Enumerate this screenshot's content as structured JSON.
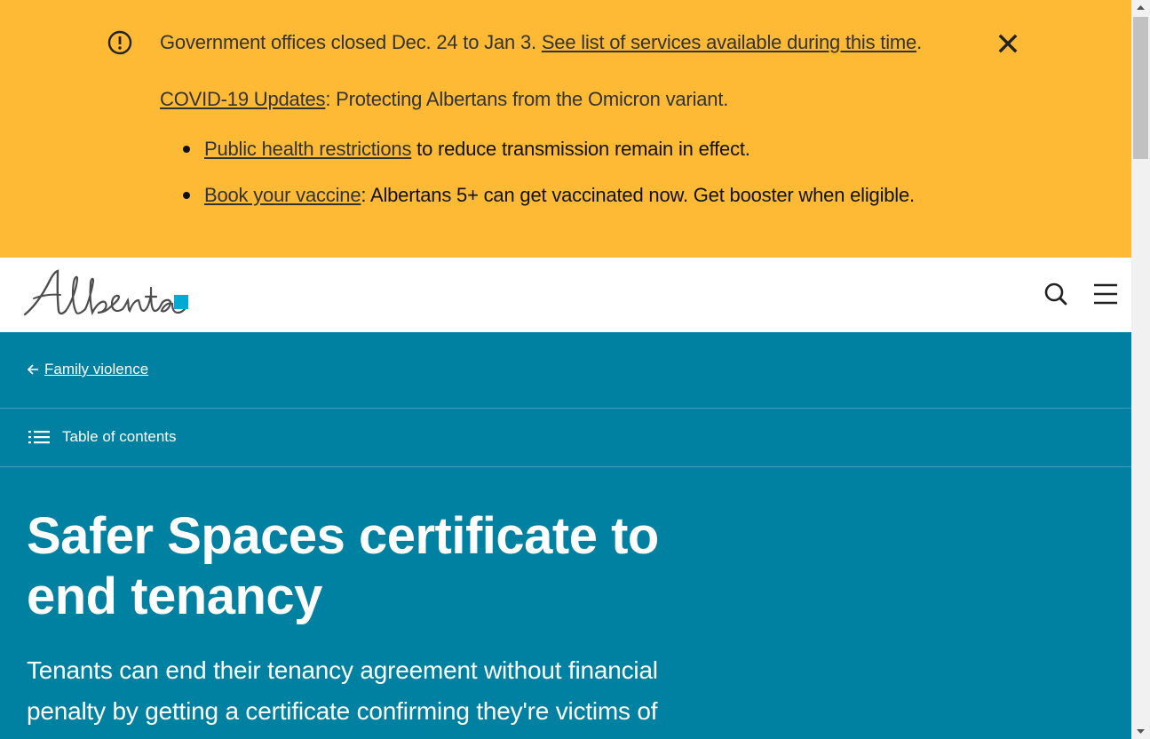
{
  "alert": {
    "icon": "exclamation-circle-icon",
    "line1_text": "Government offices closed Dec. 24 to Jan 3. ",
    "line1_link": "See list of services available during this time",
    "line1_end": ".",
    "line2_link": "COVID-19 Updates",
    "line2_text": ": Protecting Albertans from the Omicron variant.",
    "bullets": [
      {
        "link": "Public health restrictions",
        "text": " to reduce transmission remain in effect."
      },
      {
        "link": "Book your vaccine",
        "text": ": Albertans 5+ can get vaccinated now. Get booster when eligible."
      }
    ],
    "close_icon": "close-icon",
    "background": "#feba35"
  },
  "header": {
    "logo_text": "Alberta",
    "search_icon": "search-icon",
    "menu_icon": "hamburger-menu-icon"
  },
  "hero": {
    "background": "#0081a2",
    "breadcrumb": "Family violence",
    "toc_label": "Table of contents",
    "title": "Safer Spaces certificate to end tenancy",
    "lead": "Tenants can end their tenancy agreement without financial penalty by getting a certificate confirming they're victims of"
  }
}
